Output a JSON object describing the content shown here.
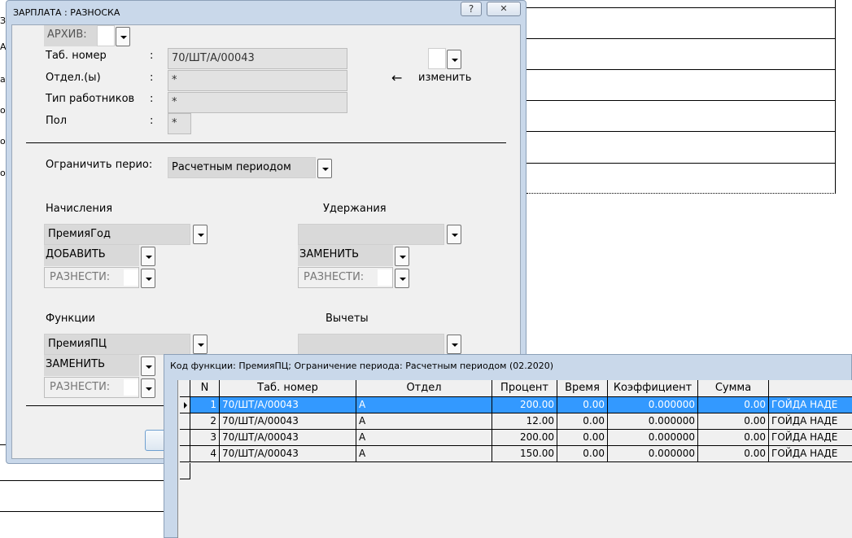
{
  "dialog": {
    "title": "ЗАРПЛАТА : РАЗНОСКА",
    "help_glyph": "?",
    "close_glyph": "✕",
    "archive_label": "АРХИВ:",
    "tab_label": "Таб. номер",
    "tab_value": "70/ШТ/А/00043",
    "dept_label": "Отдел.(ы)",
    "dept_value": "*",
    "type_label": "Тип работников",
    "type_value": "*",
    "sex_label": "Пол",
    "sex_value": "*",
    "colon": ":",
    "arrow": "←",
    "change_label": "изменить",
    "limit_label": "Ограничить перио:",
    "limit_value": "Расчетным периодом",
    "accruals_label": "Начисления",
    "accrual_value": "ПремияГод",
    "accrual_action": "ДОБАВИТЬ",
    "deductions_label": "Удержания",
    "deduction_action": "ЗАМЕНИТЬ",
    "functions_label": "Функции",
    "function_value": "ПремияПЦ",
    "function_action": "ЗАМЕНИТЬ",
    "vychety_label": "Вычеты",
    "distribute_label": "РАЗНЕСТИ:"
  },
  "popup": {
    "title": "Код функции: ПремияПЦ;  Ограничение периода: Расчетным периодом (02.2020)",
    "columns": [
      "N",
      "Таб. номер",
      "Отдел",
      "Процент",
      "Время",
      "Коэффициент",
      "Сумма"
    ],
    "rows": [
      [
        "1",
        "70/ШТ/А/00043",
        "А",
        "200.00",
        "0.00",
        "0.000000",
        "0.00",
        "ГОЙДА НАДЕ"
      ],
      [
        "2",
        "70/ШТ/А/00043",
        "А",
        "12.00",
        "0.00",
        "0.000000",
        "0.00",
        "ГОЙДА НАДЕ"
      ],
      [
        "3",
        "70/ШТ/А/00043",
        "А",
        "200.00",
        "0.00",
        "0.000000",
        "0.00",
        "ГОЙДА НАДЕ"
      ],
      [
        "4",
        "70/ШТ/А/00043",
        "А",
        "150.00",
        "0.00",
        "0.000000",
        "0.00",
        "ГОЙДА НАДЕ"
      ]
    ],
    "selected_row": 0
  },
  "background": {
    "chars": [
      "З",
      "А",
      "а",
      "о",
      "о",
      "о"
    ]
  }
}
